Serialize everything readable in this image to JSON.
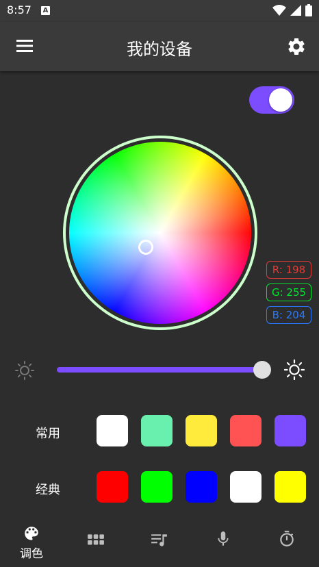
{
  "status_bar": {
    "time": "8:57",
    "notification_glyph": "A",
    "icons": [
      "wifi-icon",
      "signal-icon",
      "battery-icon"
    ]
  },
  "app_bar": {
    "title": "我的设备",
    "left_icon": "menu-icon",
    "right_icon": "settings-icon"
  },
  "power_toggle": {
    "on": true
  },
  "color_wheel": {
    "rgb": {
      "r_label": "R: 198",
      "g_label": "G: 255",
      "b_label": "B: 204"
    }
  },
  "brightness": {
    "value_fraction": 1.0,
    "min_icon": "brightness-low-icon",
    "max_icon": "brightness-high-icon"
  },
  "presets": {
    "common_label": "常用",
    "common_colors": [
      "#ffffff",
      "#69f0ae",
      "#ffeb3b",
      "#ff5252",
      "#7c4dff"
    ],
    "classic_label": "经典",
    "classic_colors": [
      "#ff0000",
      "#00ff00",
      "#0000ff",
      "#ffffff",
      "#ffff00"
    ]
  },
  "bottom_nav": {
    "active_label": "调色",
    "items": [
      "palette-icon",
      "grid-icon",
      "playlist-music-icon",
      "microphone-icon",
      "timer-icon"
    ]
  },
  "colors": {
    "accent": "#7c4dff",
    "background": "#2d2d2d",
    "bar": "#3a3a3a"
  }
}
